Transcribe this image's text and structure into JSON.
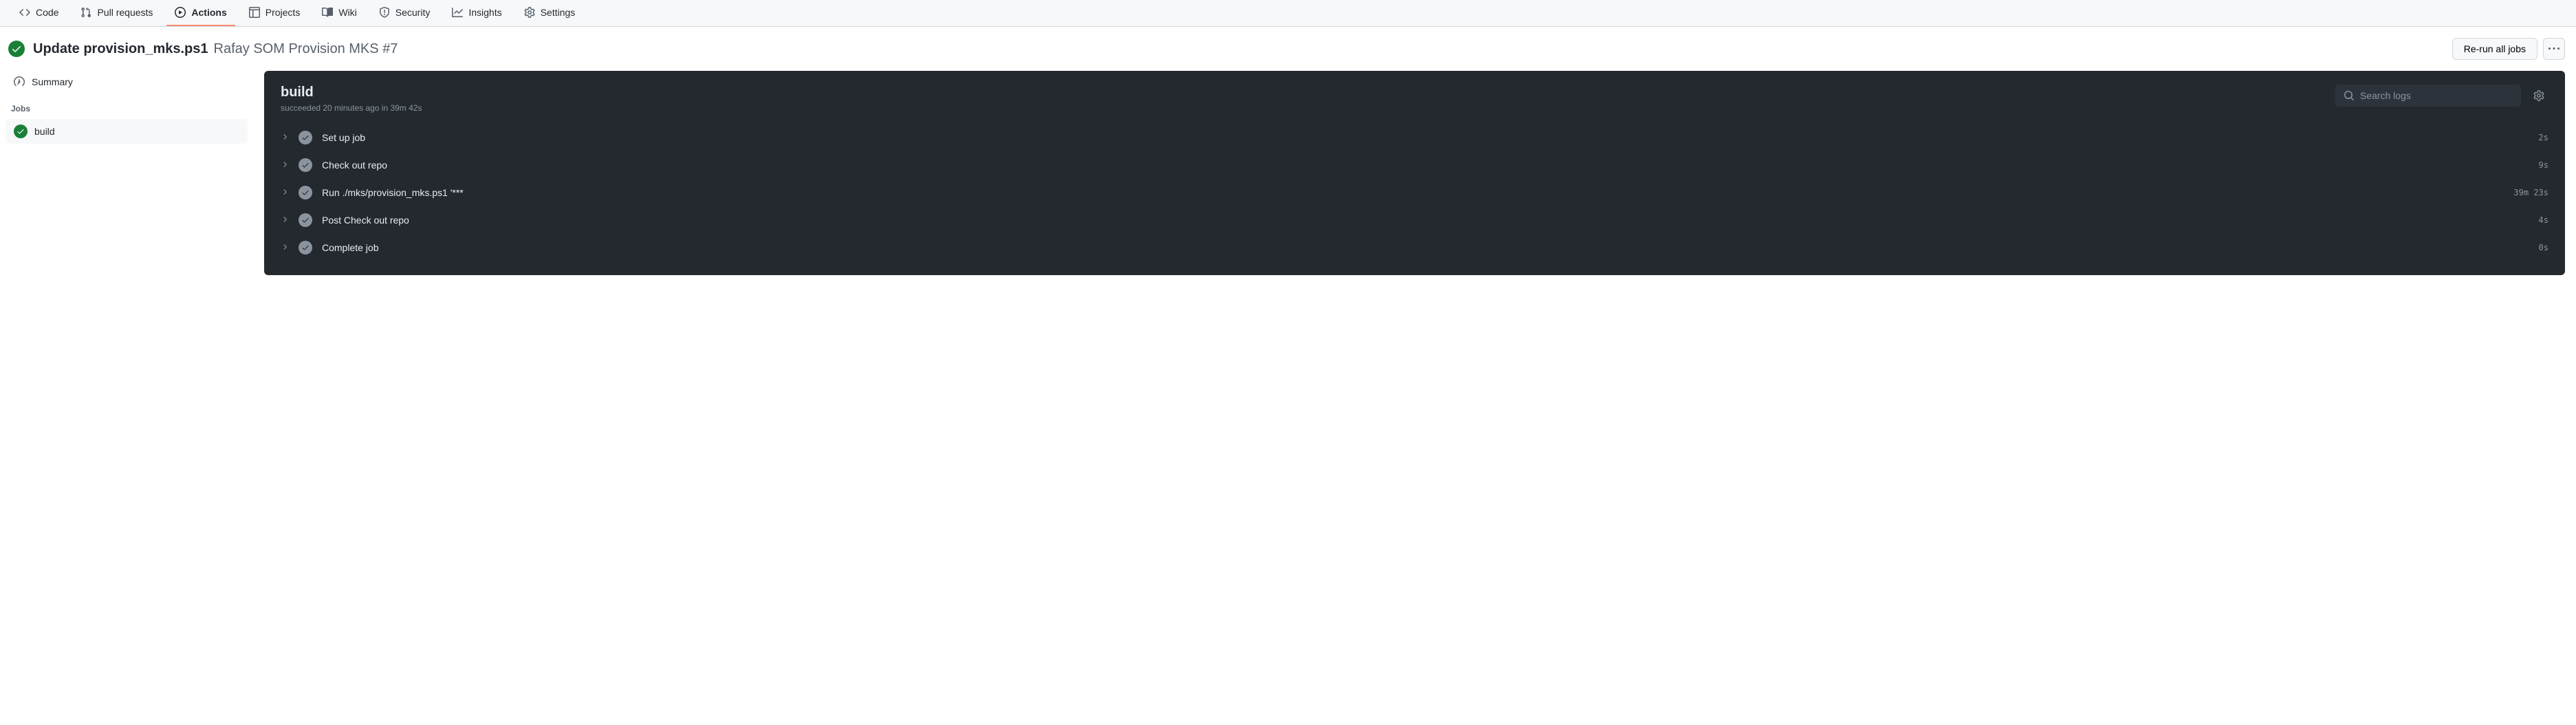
{
  "tabs": {
    "code": "Code",
    "pull_requests": "Pull requests",
    "actions": "Actions",
    "projects": "Projects",
    "wiki": "Wiki",
    "security": "Security",
    "insights": "Insights",
    "settings": "Settings"
  },
  "header": {
    "title_bold": "Update provision_mks.ps1",
    "title_muted": "Rafay SOM Provision MKS #7",
    "rerun_btn": "Re-run all jobs"
  },
  "sidebar": {
    "summary": "Summary",
    "jobs_heading": "Jobs",
    "job_name": "build"
  },
  "panel": {
    "title": "build",
    "subtitle": "succeeded 20 minutes ago in 39m 42s",
    "search_placeholder": "Search logs"
  },
  "steps": [
    {
      "name": "Set up job",
      "duration": "2s"
    },
    {
      "name": "Check out repo",
      "duration": "9s"
    },
    {
      "name": "Run ./mks/provision_mks.ps1 '***",
      "duration": "39m 23s"
    },
    {
      "name": "Post Check out repo",
      "duration": "4s"
    },
    {
      "name": "Complete job",
      "duration": "0s"
    }
  ]
}
